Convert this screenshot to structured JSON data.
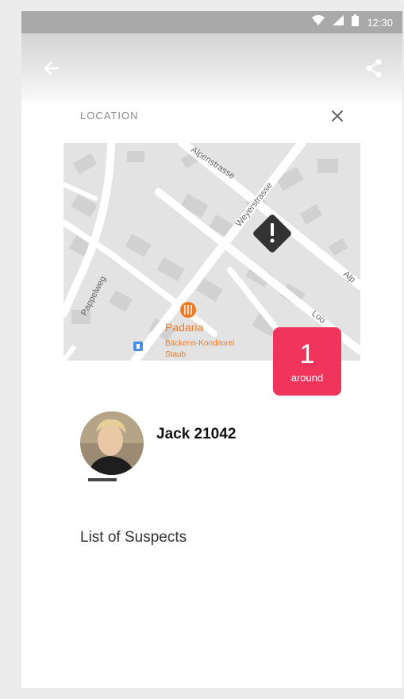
{
  "status_bar": {
    "time": "12:30"
  },
  "panel": {
    "section_label": "LOCATION"
  },
  "map": {
    "streets": [
      "Alpenstrasse",
      "Weyerstrasse",
      "Pappelweg",
      "Alp",
      "Loo"
    ],
    "poi": {
      "name": "Padaria",
      "line1": "Bäckerei-Konditorei",
      "line2": "Staub"
    },
    "colors": {
      "land": "#e3e3e3",
      "road": "#ffffff",
      "building": "#d0d0d0",
      "poi": "#ef7b25",
      "marker": "#333333"
    }
  },
  "badge": {
    "count": "1",
    "label": "around",
    "color": "#f0345c"
  },
  "suspect": {
    "name": "Jack 21042"
  },
  "list": {
    "title": "List of Suspects"
  },
  "icons": [
    "wifi-icon",
    "signal-icon",
    "battery-icon",
    "back-arrow-icon",
    "share-icon",
    "close-icon",
    "warning-icon",
    "restaurant-icon",
    "parking-icon"
  ]
}
